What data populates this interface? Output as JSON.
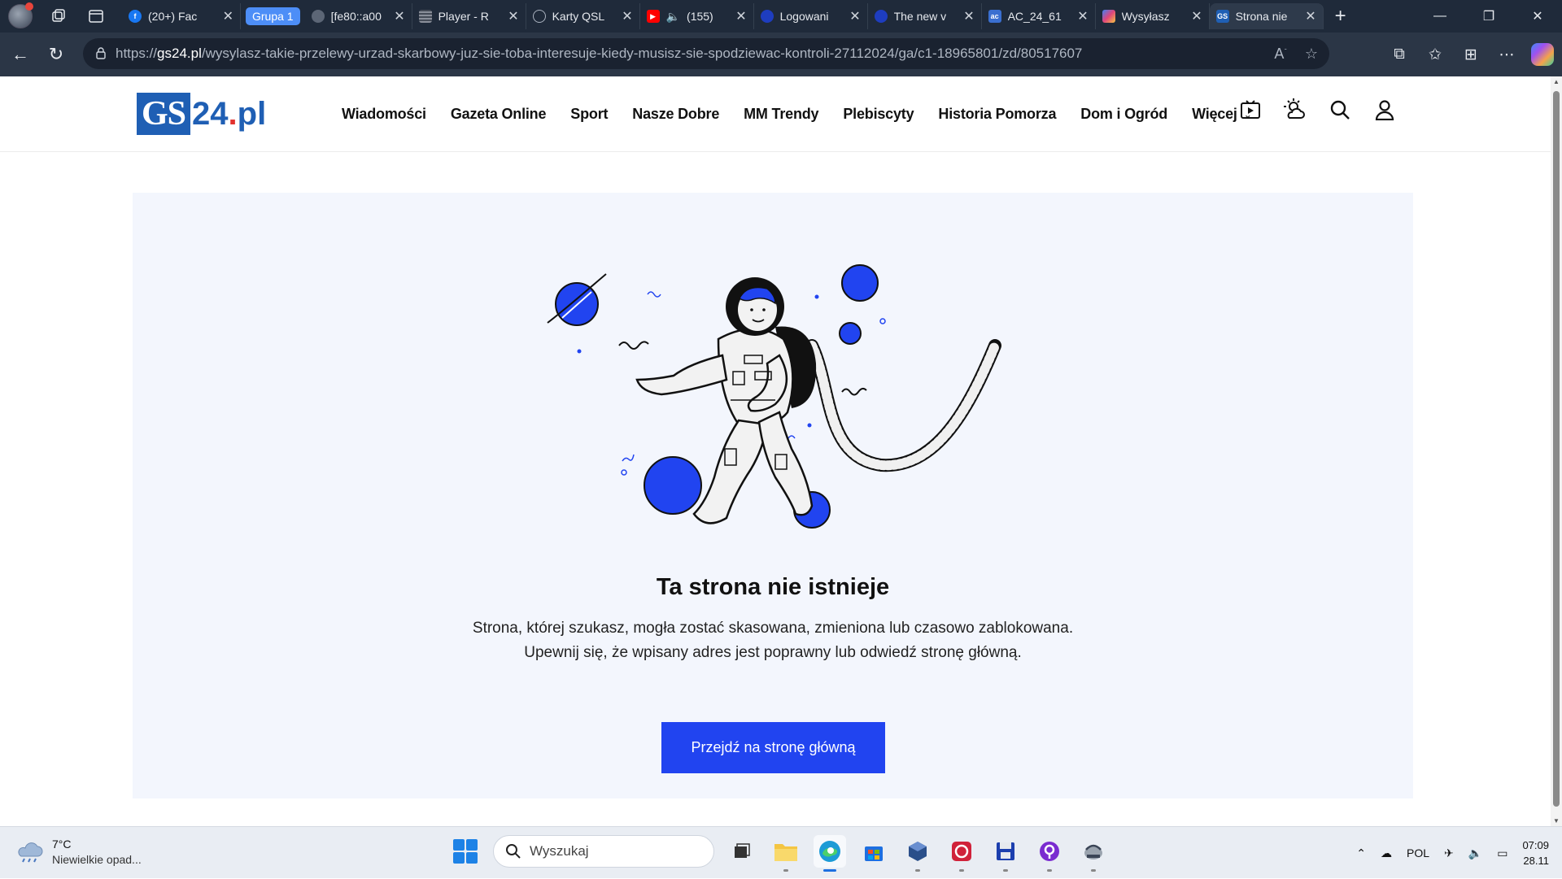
{
  "browser": {
    "tabs": [
      {
        "title": "(20+) Fac",
        "favicon": "facebook-icon",
        "color": "#1877f2"
      },
      {
        "title": "[fe80::a00",
        "favicon": "web-icon",
        "color": "#7a8596"
      },
      {
        "title": "Player - R",
        "favicon": "player-icon",
        "color": "#8a8f9a"
      },
      {
        "title": "Karty QSL",
        "favicon": "globe-icon",
        "color": "#7a8596"
      },
      {
        "title": "(155)",
        "favicon": "youtube-icon",
        "color": "#ff0000"
      },
      {
        "title": "Logowani",
        "favicon": "eu-icon",
        "color": "#2c4bd8"
      },
      {
        "title": "The new v",
        "favicon": "eu-icon",
        "color": "#2c4bd8"
      },
      {
        "title": "AC_24_61",
        "favicon": "ac-icon",
        "color": "#3a6fd0"
      },
      {
        "title": "Wysyłasz",
        "favicon": "wysylasz-icon",
        "color": "#e0457b"
      },
      {
        "title": "Strona nie",
        "favicon": "gs24-icon",
        "color": "#1f5fb4"
      }
    ],
    "group_label": "Grupa 1",
    "url_domain": "gs24.pl",
    "url_prefix": "https://",
    "url_path": "/wysylasz-takie-przelewy-urzad-skarbowy-juz-sie-toba-interesuje-kiedy-musisz-sie-spodziewac-kontroli-27112024/ga/c1-18965801/zd/80517607"
  },
  "site": {
    "logo_gs": "GS",
    "logo_num": "24",
    "logo_dot": ".",
    "logo_pl": "pl",
    "logo_color": "#1f5fb4",
    "nav": [
      "Wiadomości",
      "Gazeta Online",
      "Sport",
      "Nasze Dobre",
      "MM Trendy",
      "Plebiscyty",
      "Historia Pomorza",
      "Dom i Ogród",
      "Więcej"
    ]
  },
  "error": {
    "title": "Ta strona nie istnieje",
    "line1": "Strona, której szukasz, mogła zostać skasowana, zmieniona lub czasowo zablokowana.",
    "line2": "Upewnij się, że wpisany adres jest poprawny lub odwiedź stronę główną.",
    "button": "Przejdź na stronę główną",
    "accent": "#2144f0"
  },
  "taskbar": {
    "temp": "7°C",
    "weather": "Niewielkie opad...",
    "search_placeholder": "Wyszukaj",
    "lang": "POL",
    "time": "07:09",
    "date": "28.11"
  }
}
